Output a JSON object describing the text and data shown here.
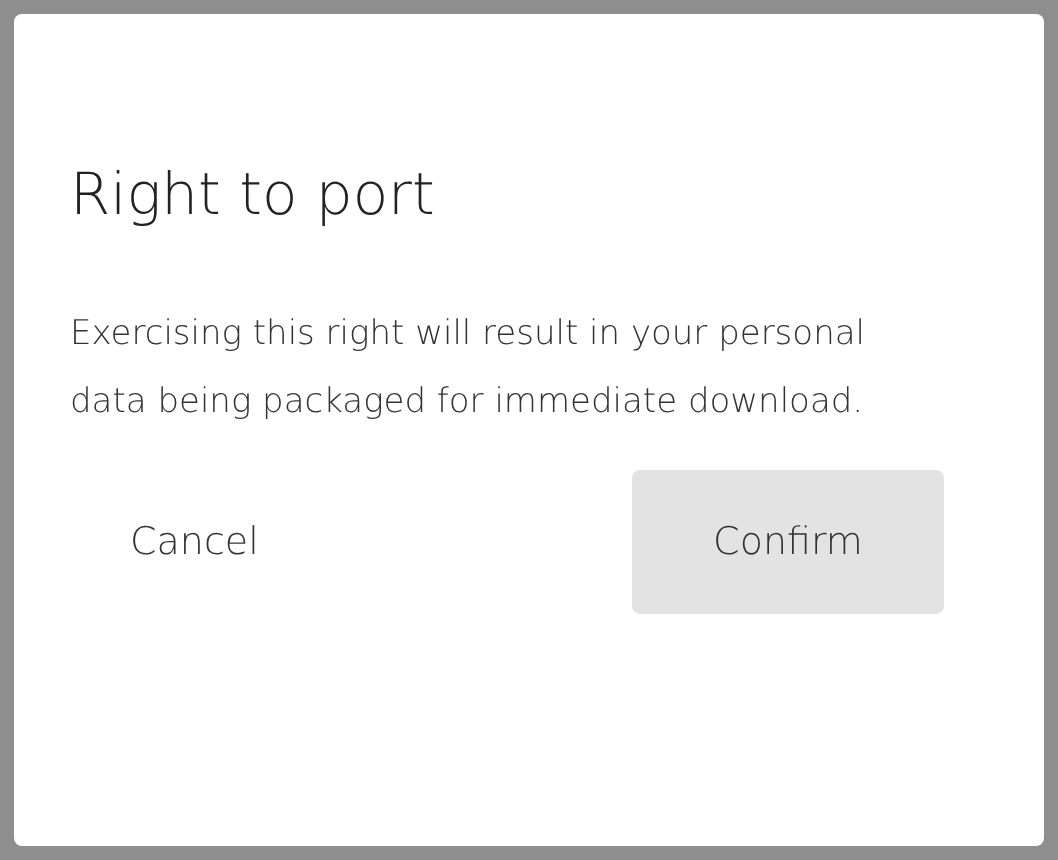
{
  "dialog": {
    "title": "Right to port",
    "message": "Exercising this right will result in your personal data being packaged for immediate download.",
    "buttons": [
      {
        "label": "Cancel",
        "kind": "text"
      },
      {
        "label": "Confirm",
        "kind": "filled"
      }
    ]
  }
}
